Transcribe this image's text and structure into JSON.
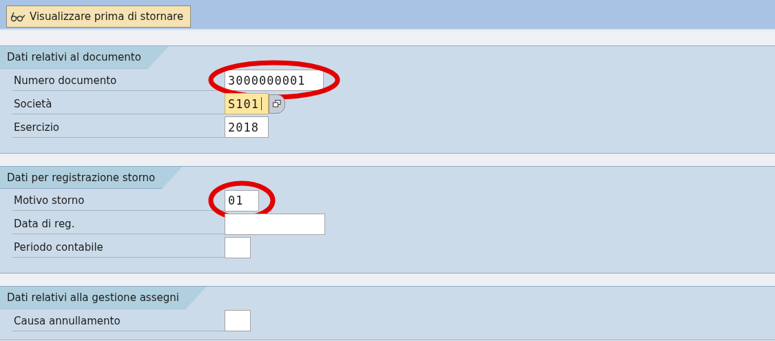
{
  "toolbar": {
    "button": {
      "label": "Visualizzare prima di stornare"
    }
  },
  "sections": [
    {
      "title": "Dati relativi al documento",
      "fields": [
        {
          "label": "Numero documento",
          "value": "3000000001",
          "focused": false,
          "value_help": false,
          "circled": true
        },
        {
          "label": "Società",
          "value": "S101",
          "focused": true,
          "value_help": true,
          "circled": false
        },
        {
          "label": "Esercizio",
          "value": "2018",
          "focused": false,
          "value_help": false,
          "circled": false
        }
      ]
    },
    {
      "title": "Dati per registrazione storno",
      "fields": [
        {
          "label": "Motivo storno",
          "value": "01",
          "focused": false,
          "value_help": false,
          "circled": true
        },
        {
          "label": "Data di reg.",
          "focused": false,
          "value_help": false,
          "circled": false
        },
        {
          "label": "Periodo contabile",
          "focused": false,
          "value_help": false,
          "circled": false
        }
      ]
    },
    {
      "title": "Dati relativi alla gestione assegni",
      "fields": [
        {
          "label": "Causa annullamento",
          "focused": false,
          "value_help": false,
          "circled": false
        }
      ]
    }
  ]
}
